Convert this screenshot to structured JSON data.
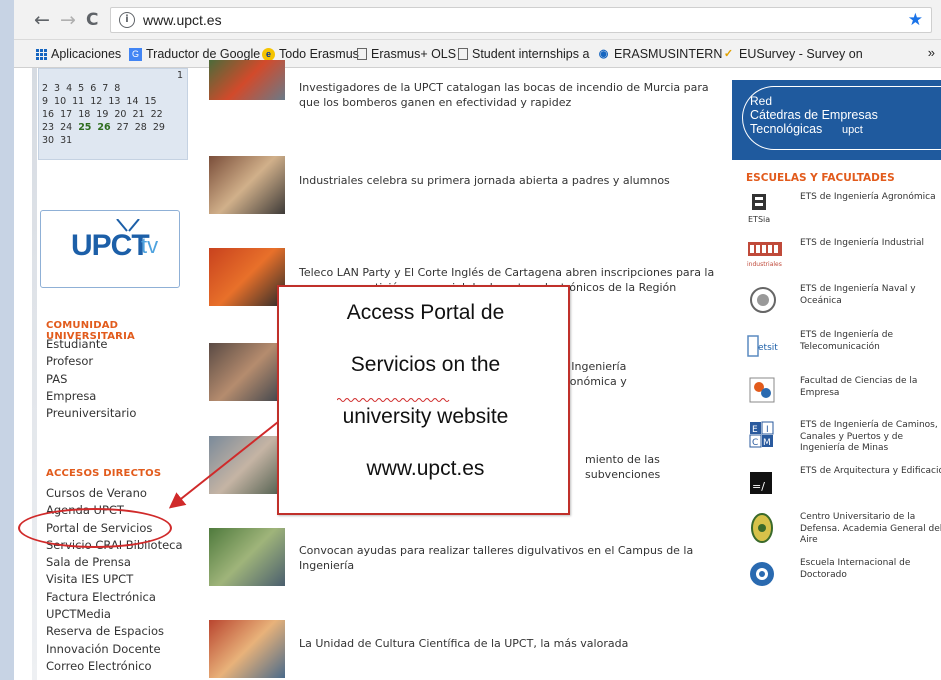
{
  "browser": {
    "url": "www.upct.es",
    "nav": {
      "back": "←",
      "forward": "→",
      "reload": "C"
    }
  },
  "bookmarks": [
    {
      "label": "Aplicaciones",
      "icon": "apps-grid-icon"
    },
    {
      "label": "Traductor de Google",
      "icon": "google-translate-icon"
    },
    {
      "label": "Todo Erasmus",
      "icon": "erasmus-e-icon"
    },
    {
      "label": "Erasmus+ OLS",
      "icon": "page-icon"
    },
    {
      "label": "Student internships a",
      "icon": "page-icon"
    },
    {
      "label": "ERASMUSINTERN",
      "icon": "erasmusintern-icon"
    },
    {
      "label": "EUSurvey - Survey on",
      "icon": "eusurvey-icon"
    }
  ],
  "calendar": {
    "rows": [
      [
        "1"
      ],
      [
        "2",
        "3",
        "4",
        "5",
        "6",
        "7",
        "8"
      ],
      [
        "9",
        "10",
        "11",
        "12",
        "13",
        "14",
        "15"
      ],
      [
        "16",
        "17",
        "18",
        "19",
        "20",
        "21",
        "22"
      ],
      [
        "23",
        "24",
        "25",
        "26",
        "27",
        "28",
        "29"
      ],
      [
        "30",
        "31"
      ]
    ],
    "highlighted": [
      "25",
      "26"
    ]
  },
  "upcttv": {
    "logo": "UPCT",
    "tv": "tv"
  },
  "comunidad": {
    "title": "COMUNIDAD UNIVERSITARIA",
    "items": [
      "Estudiante",
      "Profesor",
      "PAS",
      "Empresa",
      "Preuniversitario"
    ]
  },
  "accesos": {
    "title": "ACCESOS DIRECTOS",
    "items": [
      "Cursos de Verano",
      "Agenda UPCT",
      "Portal de Servicios",
      "Servicio CRAI Biblioteca",
      "Sala de Prensa",
      "Visita IES UPCT",
      "Factura Electrónica",
      "UPCTMedia",
      "Reserva de Espacios",
      "Innovación Docente",
      "Correo Electrónico"
    ]
  },
  "news": [
    {
      "text": "Investigadores de la UPCT catalogan las bocas de incendio de Murcia para que los bomberos ganen en efectividad y rapidez"
    },
    {
      "text": "Industriales celebra su primera jornada abierta a padres y alumnos"
    },
    {
      "text": "Teleco LAN Party y El Corte Inglés de Cartagena abren inscripciones para la mayor competición presencial de deportes electrónicos de la Región"
    },
    {
      "text": "ian Ingeniería Agronómica y"
    },
    {
      "text": "miento de las subvenciones"
    },
    {
      "text": "Convocan ayudas para realizar talleres digulvativos en el Campus de la Ingeniería"
    },
    {
      "text": "La Unidad de Cultura Científica de la UPCT, la más valorada"
    }
  ],
  "banner": {
    "line1": "Red",
    "line2": "Cátedras de Empresas Tecnológicas",
    "line3": "upct"
  },
  "escuelas": {
    "title": "ESCUELAS Y FACULTADES",
    "items": [
      {
        "name": "ETS de Ingeniería Agronómica",
        "icon_text": "ETSia"
      },
      {
        "name": "ETS de Ingeniería Industrial",
        "icon_text": "industriales"
      },
      {
        "name": "ETS de Ingeniería Naval y Oceánica",
        "icon_text": ""
      },
      {
        "name": "ETS de Ingeniería de Telecomunicación",
        "icon_text": "etsit"
      },
      {
        "name": "Facultad de Ciencias de la Empresa",
        "icon_text": ""
      },
      {
        "name": "ETS de Ingeniería de Caminos, Canales y Puertos y de Ingeniería de Minas",
        "icon_text": ""
      },
      {
        "name": "ETS de Arquitectura y Edificación",
        "icon_text": ""
      },
      {
        "name": "Centro Universitario de la Defensa. Academia General del Aire",
        "icon_text": ""
      },
      {
        "name": "Escuela Internacional de Doctorado",
        "icon_text": ""
      }
    ]
  },
  "callout": {
    "lines": [
      "Access Portal de",
      "Servicios on the",
      "university website",
      "www.upct.es"
    ]
  },
  "colors": {
    "accent_orange": "#e25b1c",
    "callout_red": "#c0302a",
    "link_blue": "#1565c0"
  }
}
